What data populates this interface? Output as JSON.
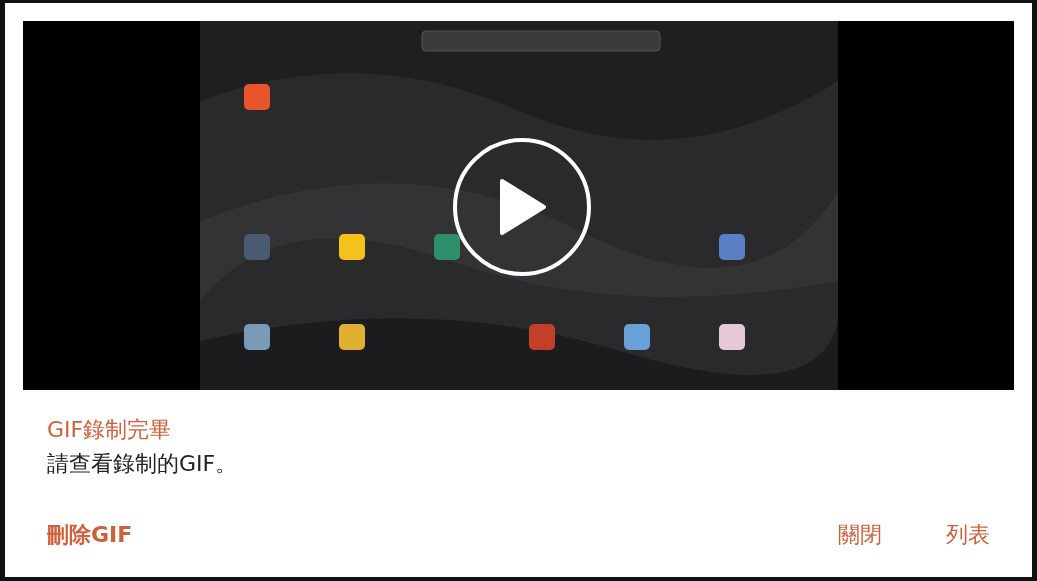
{
  "dialog": {
    "title": "GIF錄制完畢",
    "message": "請查看錄制的GIF。"
  },
  "buttons": [
    {
      "label": "刪除GIF",
      "kind": "left"
    },
    {
      "label": "關閉",
      "kind": "right"
    },
    {
      "label": "列表",
      "kind": "right"
    }
  ]
}
